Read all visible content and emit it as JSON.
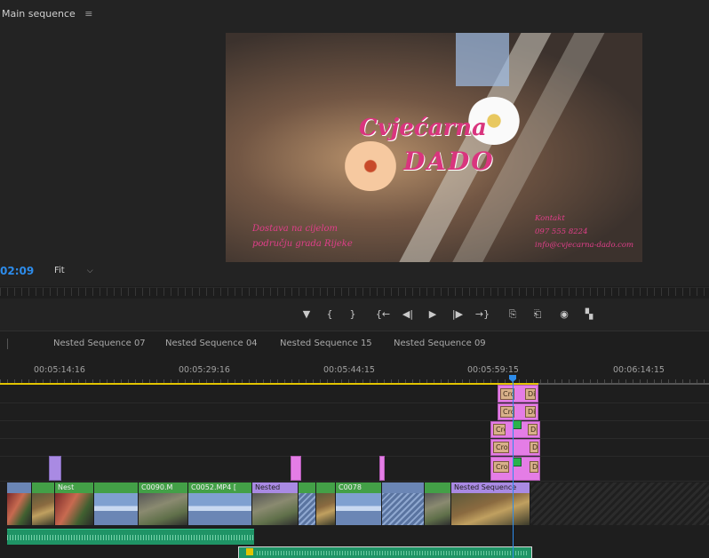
{
  "monitor": {
    "title": "Main sequence",
    "menu_glyph": "≡",
    "timecode": "02:09",
    "zoom": "Fit",
    "zoom_chevron": "⌵",
    "frame": {
      "title_line1": "Cvjećarna",
      "title_line2": "DADO",
      "left_line1": "Dostava na cijelom",
      "left_line2": "području grada Rijeke",
      "right_line1": "Kontakt",
      "right_line2": "097 555 8224",
      "right_line3": "info@cvjecarna-dado.com"
    }
  },
  "transport": {
    "marker": "▼",
    "mark_in": "{",
    "mark_out": "}",
    "go_in": "{←",
    "step_back": "◀|",
    "play": "▶",
    "step_fwd": "|▶",
    "go_out": "→}",
    "lift": "⎘",
    "extract": "⎗",
    "export_frame": "◉",
    "compare": "▚"
  },
  "timeline": {
    "tabs": [
      "Nested Sequence 07",
      "Nested Sequence 04",
      "Nested Sequence 15",
      "Nested Sequence 09"
    ],
    "ruler": [
      "00:05:14:16",
      "00:05:29:16",
      "00:05:44:15",
      "00:05:59:15",
      "00:06:14:15"
    ],
    "transitions": [
      "Cro",
      "Di",
      "Cro",
      "Di",
      "Cro",
      "Di",
      "Cros",
      "Di",
      "Cros",
      "Di"
    ],
    "v1_clips": [
      "Nest",
      "C0090.M",
      "C0052.MP4 [",
      "Nested",
      "C0078",
      "Nested Sequence"
    ]
  }
}
